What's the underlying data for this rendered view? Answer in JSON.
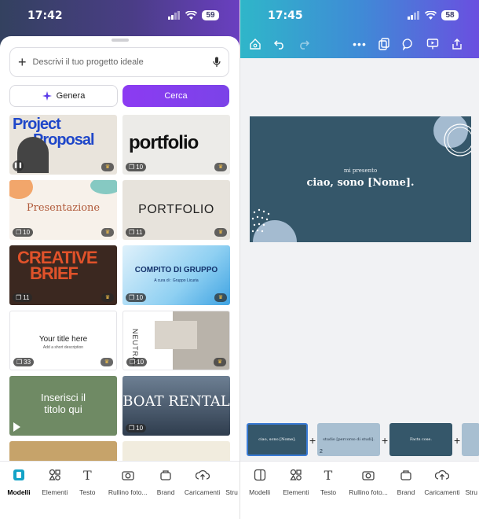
{
  "left": {
    "status_time": "17:42",
    "battery": "59",
    "search_placeholder": "Descrivi il tuo progetto ideale",
    "genera_label": "Genera",
    "cerca_label": "Cerca",
    "templates": [
      {
        "title": "Project Proposal",
        "pages": "",
        "line1": "Project",
        "line2": "Proposal"
      },
      {
        "title": "portfolio",
        "pages": "10"
      },
      {
        "title": "Presentazione",
        "pages": "10"
      },
      {
        "title": "PORTFOLIO",
        "pages": "11"
      },
      {
        "title": "CREATIVE BRIEF",
        "pages": "11",
        "line1": "CREATIVE",
        "line2": "BRIEF"
      },
      {
        "title": "COMPITO DI GRUPPO",
        "subtitle": "A cura di : Gruppo Licuria",
        "pages": "10"
      },
      {
        "title": "Your title here",
        "subtitle": "Add a short description",
        "pages": "33"
      },
      {
        "title": "NEUTRAL",
        "pages": "10"
      },
      {
        "title": "Inserisci il titolo qui",
        "line1": "Inserisci il",
        "line2": "titolo qui",
        "pages": ""
      },
      {
        "title": "BOAT RENTAL",
        "pages": "10"
      }
    ],
    "tabs": [
      {
        "label": "Modelli",
        "icon": "templates-icon"
      },
      {
        "label": "Elementi",
        "icon": "elements-icon"
      },
      {
        "label": "Testo",
        "icon": "text-icon"
      },
      {
        "label": "Rullino foto...",
        "icon": "camera-icon"
      },
      {
        "label": "Brand",
        "icon": "brand-icon"
      },
      {
        "label": "Caricamenti",
        "icon": "upload-icon"
      },
      {
        "label": "Stru",
        "icon": "tools-icon"
      }
    ]
  },
  "right": {
    "status_time": "17:45",
    "battery": "58",
    "slide_small": "mi presento",
    "slide_big": "ciao, sono [Nome].",
    "thumbs": [
      {
        "text": "ciao, sono [Nome].",
        "num": ""
      },
      {
        "text": "studio [percorso di studi].",
        "num": "2"
      },
      {
        "text": "Facts cose.",
        "num": ""
      }
    ],
    "tabs": [
      {
        "label": "Modelli",
        "icon": "templates-icon"
      },
      {
        "label": "Elementi",
        "icon": "elements-icon"
      },
      {
        "label": "Testo",
        "icon": "text-icon"
      },
      {
        "label": "Rullino foto...",
        "icon": "camera-icon"
      },
      {
        "label": "Brand",
        "icon": "brand-icon"
      },
      {
        "label": "Caricamenti",
        "icon": "upload-icon"
      },
      {
        "label": "Stru",
        "icon": "tools-icon"
      }
    ]
  }
}
